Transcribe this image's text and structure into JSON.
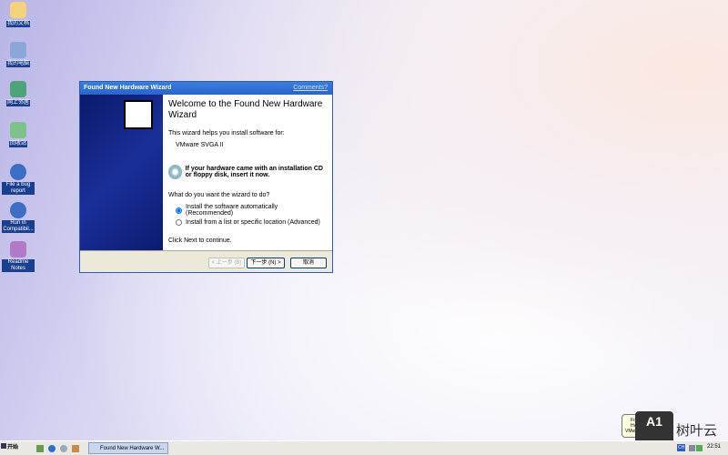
{
  "desktop": {
    "icons": [
      {
        "label": "我的文档"
      },
      {
        "label": "我的电脑"
      },
      {
        "label": "网上邻居"
      },
      {
        "label": "回收站"
      },
      {
        "label": "File a bug report"
      },
      {
        "label": "Run in Compatibil..."
      },
      {
        "label": "Readme Notes"
      }
    ]
  },
  "dialog": {
    "title": "Found New Hardware Wizard",
    "comments_link": "Comments?",
    "heading": "Welcome to the Found New Hardware Wizard",
    "intro": "This wizard helps you install software for:",
    "device": "VMware SVGA II",
    "cd_note": "If your hardware came with an installation CD or floppy disk, insert it now.",
    "question": "What do you want the wizard to do?",
    "options": [
      {
        "label": "Install the software automatically (Recommended)",
        "selected": true
      },
      {
        "label": "Install from a list or specific location (Advanced)",
        "selected": false
      }
    ],
    "continue_text": "Click Next to continue.",
    "back_label": "< 上一步 (B)",
    "next_label": "下一步 (N) >",
    "cancel_label": "取消"
  },
  "taskbar": {
    "start_label": "开始",
    "window_button": "Found New Hardware W...",
    "clock": "22:51",
    "lang": "CH"
  },
  "balloon": {
    "title": "Found New Hardware",
    "text": "VMware SVGA II"
  },
  "watermark": {
    "text": "A1",
    "brand": "树叶云"
  }
}
